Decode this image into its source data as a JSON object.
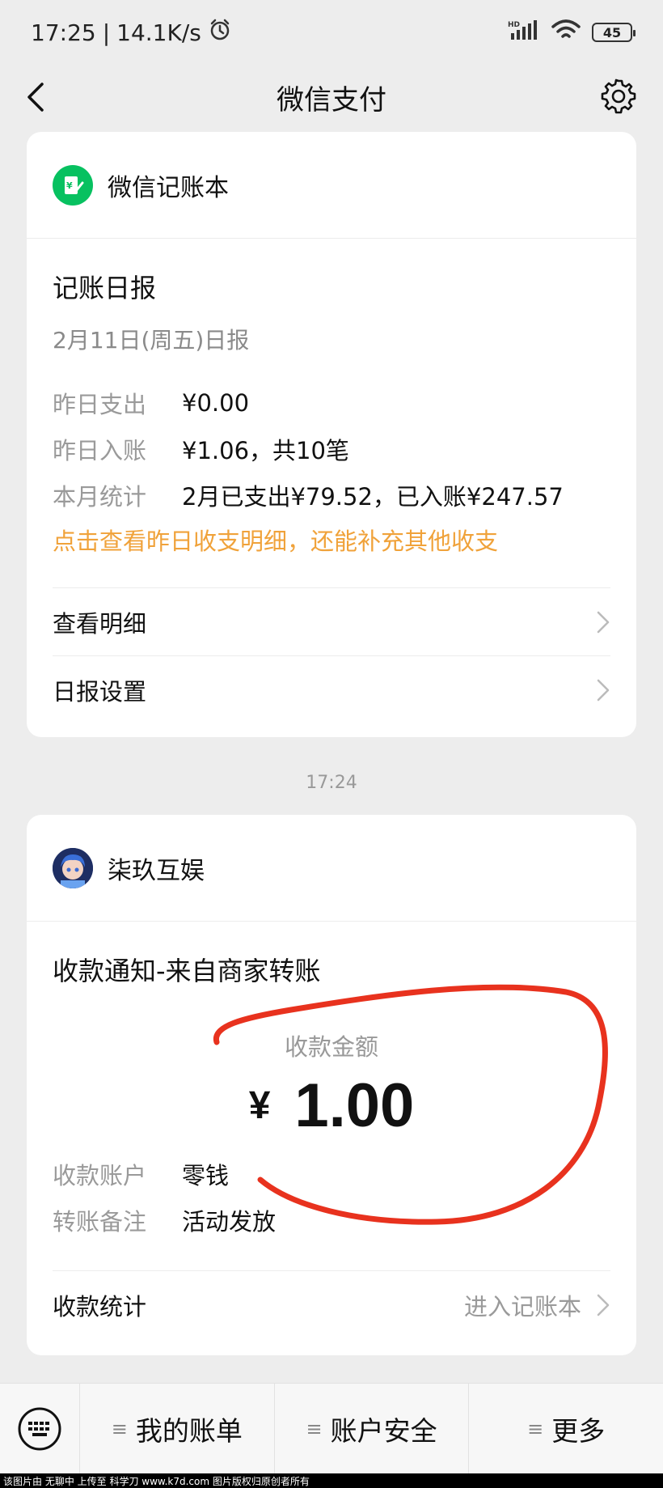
{
  "status_bar": {
    "time": "17:25",
    "network_speed": "14.1K/s",
    "battery": "45",
    "hd_label": "HD"
  },
  "nav": {
    "title": "微信支付"
  },
  "card1": {
    "app_name": "微信记账本",
    "section_title": "记账日报",
    "date_text": "2月11日(周五)日报",
    "rows": [
      {
        "key": "昨日支出",
        "value": "¥0.00"
      },
      {
        "key": "昨日入账",
        "value": "¥1.06，共10笔"
      },
      {
        "key": "本月统计",
        "value": "2月已支出¥79.52，已入账¥247.57"
      }
    ],
    "link_text": "点击查看昨日收支明细，还能补充其他收支",
    "menu": [
      {
        "label": "查看明细"
      },
      {
        "label": "日报设置"
      }
    ]
  },
  "timestamp": "17:24",
  "card2": {
    "merchant_name": "柒玖互娱",
    "section_title": "收款通知-来自商家转账",
    "amount_label": "收款金额",
    "currency": "¥",
    "amount": "1.00",
    "rows": [
      {
        "key": "收款账户",
        "value": "零钱"
      },
      {
        "key": "转账备注",
        "value": "活动发放"
      }
    ],
    "footer_label": "收款统计",
    "footer_link": "进入记账本"
  },
  "tab_bar": {
    "items": [
      {
        "label": "我的账单"
      },
      {
        "label": "账户安全"
      },
      {
        "label": "更多"
      }
    ]
  },
  "watermark": "该图片由 无聊中 上传至 科学刀 www.k7d.com 图片版权归原创者所有",
  "colors": {
    "accent_green": "#07c160",
    "link_orange": "#f0a23a",
    "annotation_red": "#e8321e"
  }
}
